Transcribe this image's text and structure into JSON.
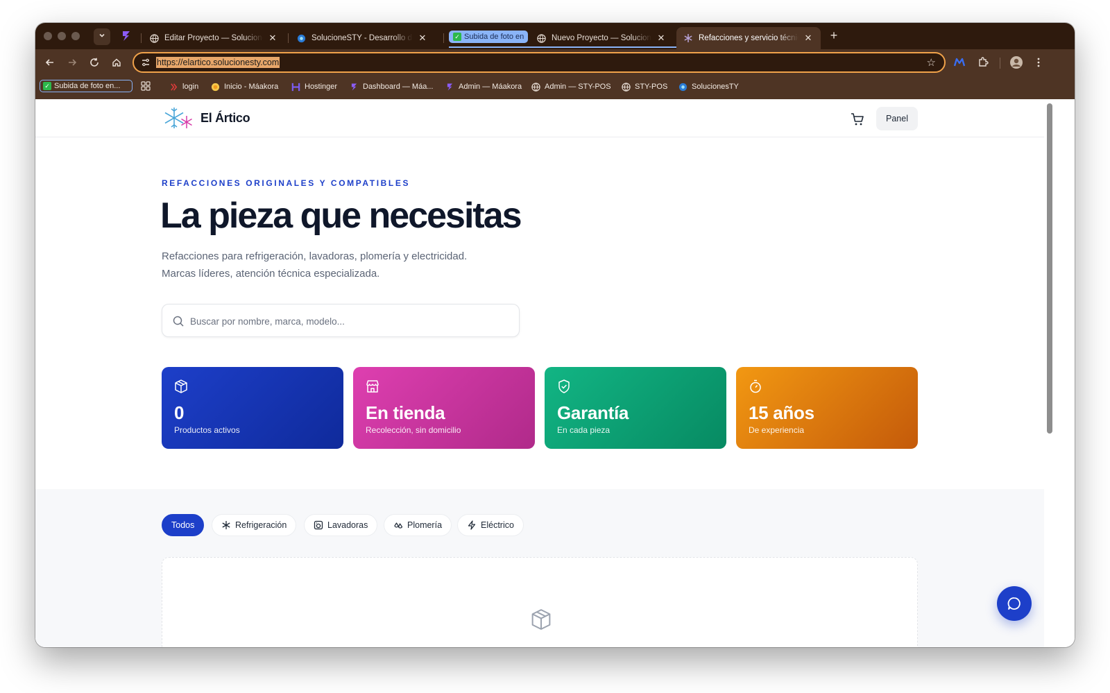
{
  "browser": {
    "tabs": [
      {
        "title": "Editar Proyecto — SolucionesSTY",
        "icon": "globe-icon"
      },
      {
        "title": "SolucioneSTY - Desarrollo de software",
        "icon": "sty-logo-icon"
      },
      {
        "title": "Nuevo Proyecto — SolucionesSTY",
        "icon": "globe-icon"
      },
      {
        "title": "Refacciones y servicio técnico",
        "icon": "snowflake-icon"
      }
    ],
    "tab_group_label": "Subida de foto en",
    "url": "https://elartico.solucionesty.com",
    "bookmark_group_label": "Subida de foto en...",
    "bookmarks": [
      "login",
      "Inicio - Máakora",
      "Hostinger",
      "Dashboard — Máa...",
      "Admin — Máakora",
      "Admin — STY-POS",
      "STY-POS",
      "SolucionesTY"
    ]
  },
  "site": {
    "brand": "El Ártico",
    "panel_label": "Panel"
  },
  "hero": {
    "eyebrow": "REFACCIONES ORIGINALES Y COMPATIBLES",
    "title": "La pieza que necesitas",
    "subtitle_line1": "Refacciones para refrigeración, lavadoras, plomería y electricidad.",
    "subtitle_line2": "Marcas líderes, atención técnica especializada."
  },
  "search": {
    "value": "",
    "placeholder": "Buscar por nombre, marca, modelo..."
  },
  "stats": [
    {
      "value": "0",
      "label": "Productos activos",
      "icon": "box-icon",
      "color": "#1d3fc9"
    },
    {
      "value": "En tienda",
      "label": "Recolección, sin domicilio",
      "icon": "store-icon",
      "color": "#d63aa8"
    },
    {
      "value": "Garantía",
      "label": "En cada pieza",
      "icon": "shield-check-icon",
      "color": "#10a878"
    },
    {
      "value": "15 años",
      "label": "De experiencia",
      "icon": "timer-icon",
      "color": "#ee8c10"
    }
  ],
  "filters": [
    {
      "label": "Todos",
      "active": true
    },
    {
      "label": "Refrigeración",
      "icon": "snowflake-icon"
    },
    {
      "label": "Lavadoras",
      "icon": "washer-icon"
    },
    {
      "label": "Plomería",
      "icon": "droplets-icon"
    },
    {
      "label": "Eléctrico",
      "icon": "bolt-icon"
    }
  ],
  "colors": {
    "primary": "#1d3fc9",
    "browser_frame": "#4e3424",
    "omnibox_focus": "#f0a24a"
  }
}
